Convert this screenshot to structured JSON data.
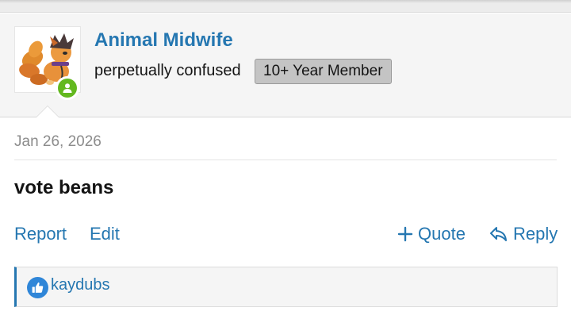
{
  "user": {
    "name": "Animal Midwife",
    "title": "perpetually confused",
    "banner": "10+ Year Member",
    "status": "online",
    "avatar_icon": "fox-character-avatar"
  },
  "post": {
    "date": "Jan 26, 2026",
    "body": "vote beans"
  },
  "actions": {
    "report": "Report",
    "edit": "Edit",
    "quote": "Quote",
    "reply": "Reply"
  },
  "reactions": {
    "icon": "thumbs-up-icon",
    "users": "kaydubs"
  },
  "colors": {
    "link": "#2577b1",
    "online": "#63b81f",
    "banner_bg": "#c4c4c4",
    "like": "#2f86d8"
  }
}
